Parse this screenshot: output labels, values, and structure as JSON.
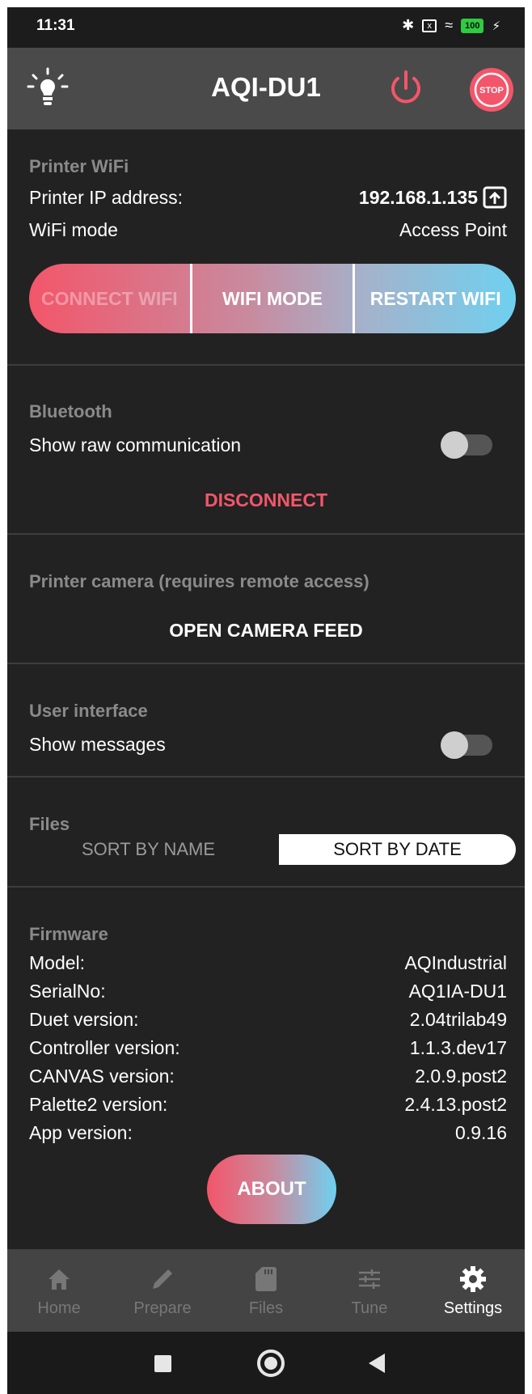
{
  "status_bar": {
    "time": "11:31",
    "bluetooth": "✱",
    "wifi": "≈",
    "battery": "100",
    "charging": "⚡"
  },
  "app_bar": {
    "title": "AQI-DU1",
    "stop_label": "STOP"
  },
  "printer_wifi": {
    "title": "Printer WiFi",
    "ip_label": "Printer IP address:",
    "ip_value": "192.168.1.135",
    "mode_label": "WiFi mode",
    "mode_value": "Access Point",
    "buttons": [
      "CONNECT WIFI",
      "WIFI MODE",
      "RESTART WIFI"
    ]
  },
  "bluetooth": {
    "title": "Bluetooth",
    "raw_label": "Show raw communication",
    "raw_enabled": false,
    "disconnect_label": "DISCONNECT"
  },
  "camera": {
    "title": "Printer camera (requires remote access)",
    "open_label": "OPEN CAMERA FEED"
  },
  "user_interface": {
    "title": "User interface",
    "messages_label": "Show messages",
    "messages_enabled": false
  },
  "files": {
    "title": "Files",
    "sort_name": "SORT BY NAME",
    "sort_date": "SORT BY DATE",
    "selected": "SORT BY DATE"
  },
  "firmware": {
    "title": "Firmware",
    "rows": [
      {
        "label": "Model:",
        "value": "AQIndustrial"
      },
      {
        "label": "SerialNo:",
        "value": "AQ1IA-DU1"
      },
      {
        "label": "Duet version:",
        "value": "2.04trilab49"
      },
      {
        "label": "Controller version:",
        "value": "1.1.3.dev17"
      },
      {
        "label": "CANVAS version:",
        "value": "2.0.9.post2"
      },
      {
        "label": "Palette2 version:",
        "value": "2.4.13.post2"
      },
      {
        "label": "App version:",
        "value": "0.9.16"
      }
    ],
    "about_label": "ABOUT"
  },
  "bottom_nav": {
    "items": [
      {
        "label": "Home",
        "icon": "home-icon",
        "active": false
      },
      {
        "label": "Prepare",
        "icon": "pencil-icon",
        "active": false
      },
      {
        "label": "Files",
        "icon": "sd-card-icon",
        "active": false
      },
      {
        "label": "Tune",
        "icon": "sliders-icon",
        "active": false
      },
      {
        "label": "Settings",
        "icon": "gear-icon",
        "active": true
      }
    ]
  },
  "colors": {
    "accent_red": "#f3566a",
    "accent_blue": "#6fd0f0",
    "background": "#222222",
    "appbar": "#4a4a4a"
  }
}
